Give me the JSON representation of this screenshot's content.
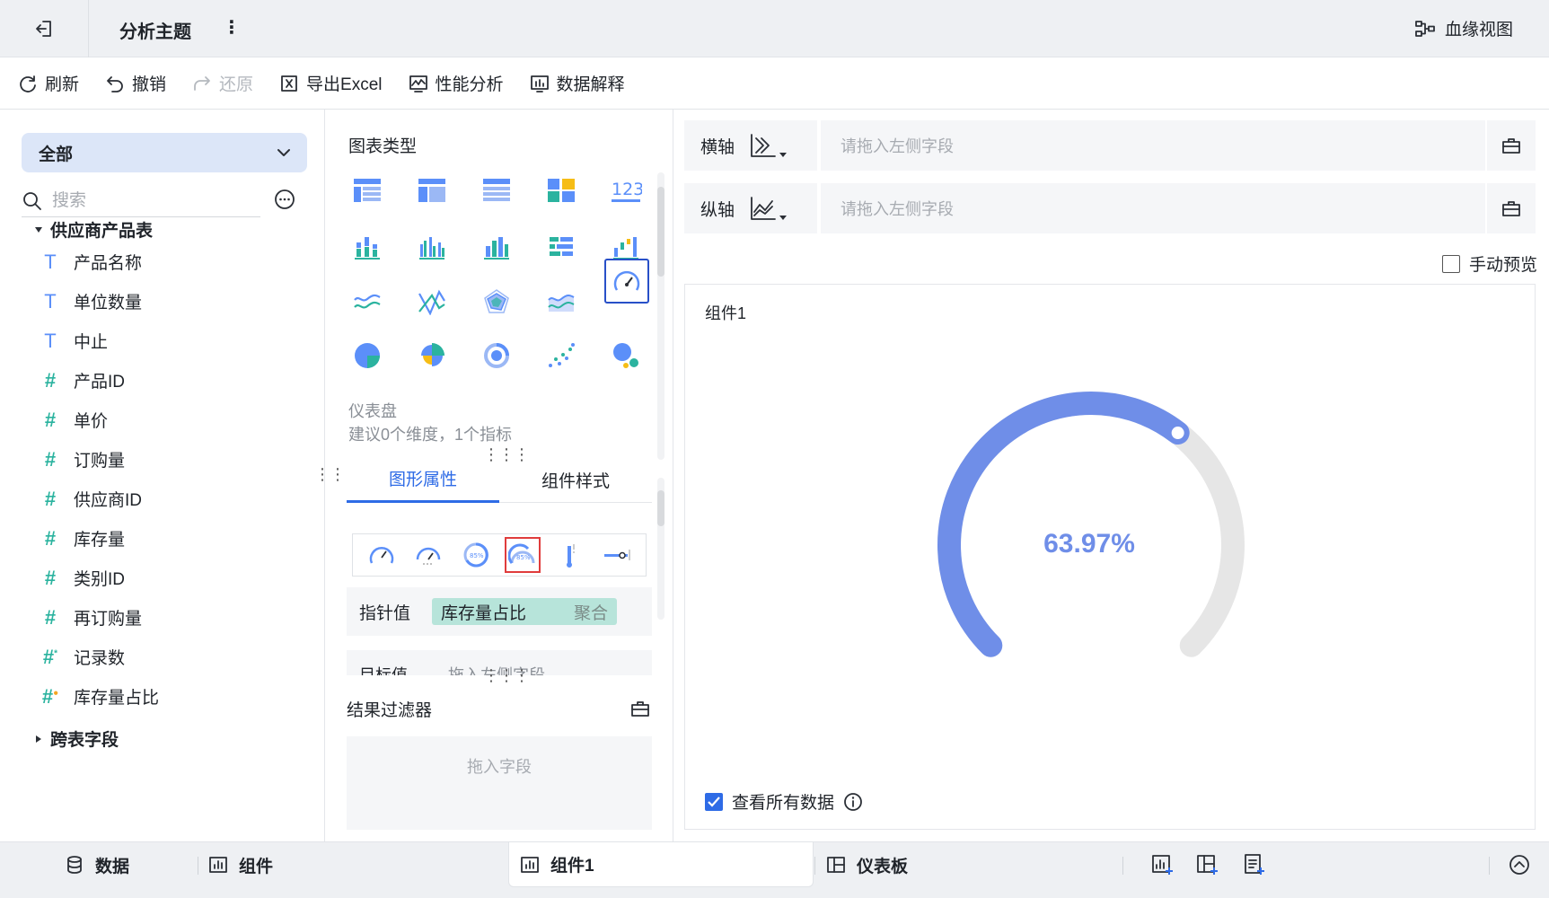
{
  "header": {
    "title": "分析主题",
    "more": "⋮",
    "lineage_label": "血缘视图"
  },
  "toolbar": {
    "refresh": "刷新",
    "undo": "撤销",
    "redo": "还原",
    "export_excel": "导出Excel",
    "perf": "性能分析",
    "explain": "数据解释"
  },
  "left_panel": {
    "scope": "全部",
    "search_placeholder": "搜索",
    "table_name": "供应商产品表",
    "fields": [
      {
        "type": "T",
        "name": "产品名称"
      },
      {
        "type": "T",
        "name": "单位数量"
      },
      {
        "type": "T",
        "name": "中止"
      },
      {
        "type": "#",
        "name": "产品ID"
      },
      {
        "type": "#",
        "name": "单价"
      },
      {
        "type": "#",
        "name": "订购量"
      },
      {
        "type": "#",
        "name": "供应商ID"
      },
      {
        "type": "#",
        "name": "库存量"
      },
      {
        "type": "#",
        "name": "类别ID"
      },
      {
        "type": "#",
        "name": "再订购量"
      },
      {
        "type": "#",
        "name": "记录数"
      },
      {
        "type": "#",
        "name": "库存量占比"
      }
    ],
    "cross_table": "跨表字段"
  },
  "middle_panel": {
    "chart_type_label": "图表类型",
    "chart_type_name": "仪表盘",
    "chart_type_tip": "建议0个维度，1个指标",
    "tab_shape": "图形属性",
    "tab_style": "组件样式",
    "pointer_label": "指针值",
    "pointer_field": "库存量占比",
    "pointer_agg": "聚合",
    "target_label": "目标值",
    "target_placeholder": "拖入左侧字段",
    "filter_label": "结果过滤器",
    "filter_drop": "拖入字段"
  },
  "right_panel": {
    "x_axis_label": "横轴",
    "y_axis_label": "纵轴",
    "axis_placeholder": "请拖入左侧字段",
    "manual_preview": "手动预览",
    "component_title": "组件1",
    "gauge_value_text": "63.97%",
    "gauge_fraction": 0.6397,
    "view_all": "查看所有数据"
  },
  "bottom_bar": {
    "data": "数据",
    "component": "组件",
    "component1": "组件1",
    "dashboard": "仪表板"
  },
  "colors": {
    "accent": "#2e6be6",
    "gauge": "#6f8ee8",
    "gauge_track": "#e6e6e6",
    "field_text_icon": "#5b8ff9",
    "field_num_icon": "#2bb39f",
    "chip": "#b7e4da",
    "selected_border": "#e03c3c"
  }
}
